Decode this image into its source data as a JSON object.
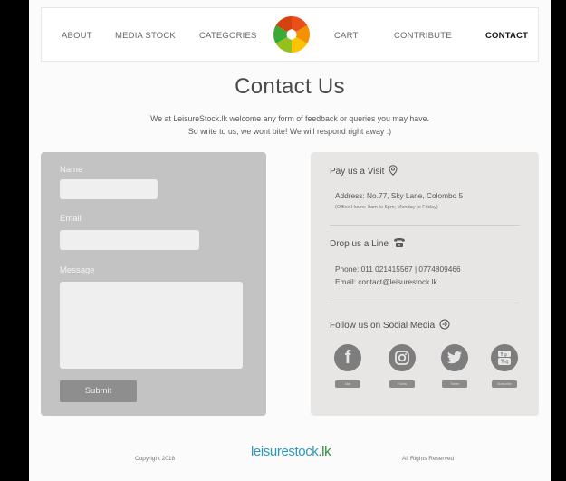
{
  "nav": {
    "items": [
      {
        "label": "ABOUT",
        "active": false
      },
      {
        "label": "MEDIA STOCK",
        "active": false
      },
      {
        "label": "CATEGORIES",
        "active": false
      },
      {
        "label": "CART",
        "active": false
      },
      {
        "label": "CONTRIBUTE",
        "active": false
      },
      {
        "label": "CONTACT",
        "active": true
      }
    ],
    "logo_icon": "aperture-logo-icon"
  },
  "main": {
    "title": "Contact Us",
    "intro_line1": "We at LeisureStock.lk welcome any form of feedback or queries you may have.",
    "intro_line2": "So write to us, we wont bite! We will respond right away :)"
  },
  "form": {
    "name_label": "Name",
    "name_value": "",
    "email_label": "Email",
    "email_value": "",
    "message_label": "Message",
    "message_value": "",
    "submit_label": "Submit"
  },
  "info": {
    "visit_heading": "Pay us a Visit",
    "visit_icon": "location-pin-icon",
    "address": "Address: No.77, Sky Lane, Colombo 5",
    "office_hours": "(Office Hours: 9am to 5pm; Monday to Friday)",
    "line_heading": "Drop us a Line",
    "line_icon": "telephone-icon",
    "phone": "Phone: 011 021415567 | 0774809466",
    "email": "Email: contact@leisurestock.lk",
    "social_heading": "Follow us on Social Media",
    "social_icon": "arrow-circle-icon",
    "social": [
      {
        "name": "facebook",
        "icon": "facebook-icon",
        "button": "Like"
      },
      {
        "name": "instagram",
        "icon": "instagram-icon",
        "button": "Follow"
      },
      {
        "name": "twitter",
        "icon": "twitter-icon",
        "button": "Tweet"
      },
      {
        "name": "youtube",
        "icon": "youtube-icon",
        "button": "Subscribe"
      }
    ]
  },
  "footer": {
    "copyright": "Copyright 2018",
    "logo_main": "leisurestock",
    "logo_suffix": ".lk",
    "rights": "All Rights Reserved"
  },
  "colors": {
    "form_panel": "#c4c3c3",
    "info_panel": "#e8e6e5",
    "logo_blue": "#2a9bbd",
    "logo_green": "#2c8f3e"
  }
}
